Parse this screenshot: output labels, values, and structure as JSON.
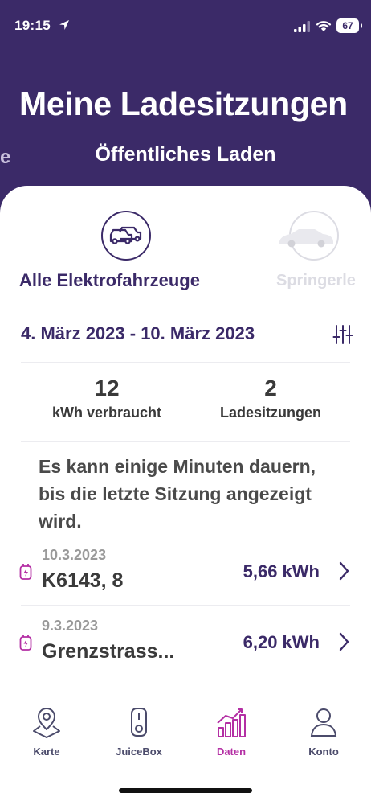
{
  "status_bar": {
    "time": "19:15",
    "battery": "67"
  },
  "header": {
    "title": "Meine Ladesitzungen",
    "section_prev": "e",
    "section": "Öffentliches Laden"
  },
  "vehicles": [
    {
      "label": "Alle Elektrofahrzeuge",
      "selected": true
    },
    {
      "label": "Springerle",
      "selected": false
    }
  ],
  "date_range": "4. März 2023 - 10. März 2023",
  "stats": [
    {
      "value": "12",
      "label": "kWh verbraucht"
    },
    {
      "value": "2",
      "label": "Ladesitzungen"
    }
  ],
  "notice": "Es kann einige Minuten dauern, bis die letzte Sitzung angezeigt wird.",
  "sessions": [
    {
      "date": "10.3.2023",
      "location": "K6143, 8",
      "energy": "5,66 kWh"
    },
    {
      "date": "9.3.2023",
      "location": "Grenzstrass...",
      "energy": "6,20 kWh"
    }
  ],
  "nav": [
    {
      "label": "Karte",
      "icon": "map-pin-icon"
    },
    {
      "label": "JuiceBox",
      "icon": "juicebox-icon"
    },
    {
      "label": "Daten",
      "icon": "chart-icon",
      "active": true
    },
    {
      "label": "Konto",
      "icon": "person-icon"
    }
  ],
  "colors": {
    "header": "#3b2a68",
    "accent": "#b42fa4",
    "text": "#3a3a3a"
  }
}
